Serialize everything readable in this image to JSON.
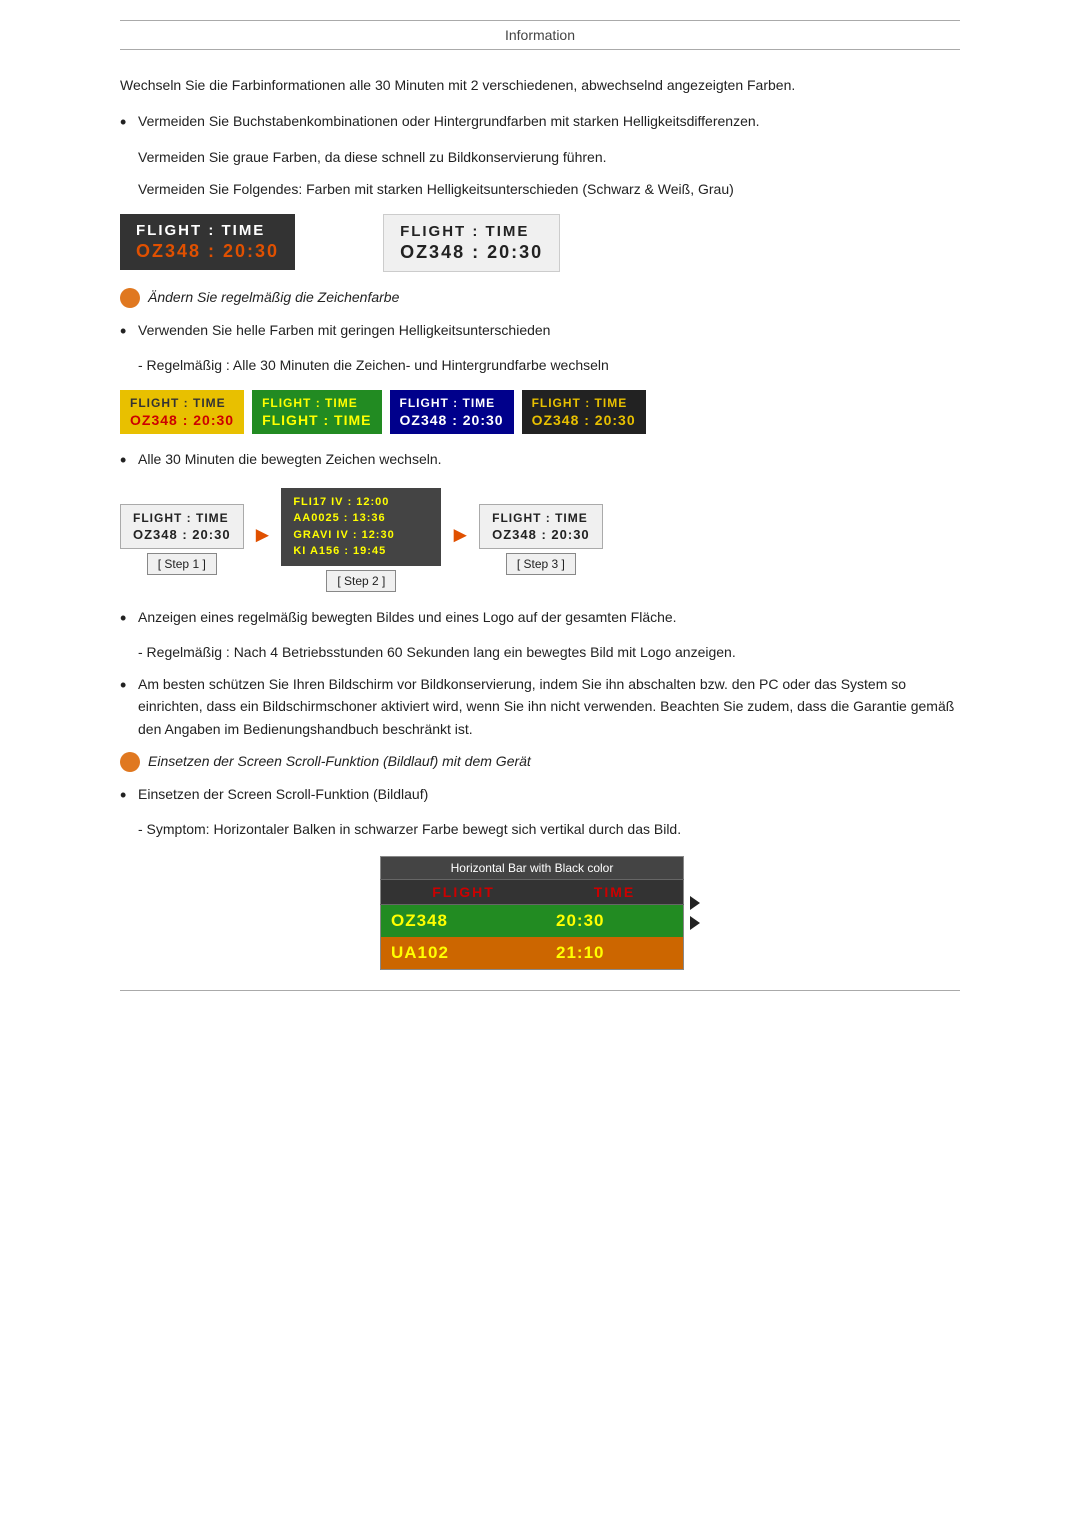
{
  "header": {
    "title": "Information"
  },
  "content": {
    "intro_paragraph": "Wechseln Sie die Farbinformationen alle 30 Minuten mit 2 verschiedenen, abwechselnd angezeigten Farben.",
    "bullet1": "Vermeiden Sie Buchstabenkombinationen oder Hintergrundfarben mit starken Helligkeitsdifferenzen.",
    "sub1": "Vermeiden Sie graue Farben, da diese schnell zu Bildkonservierung führen.",
    "sub2": "Vermeiden Sie Folgendes: Farben mit starken Helligkeitsunterschieden (Schwarz & Weiß, Grau)",
    "flight_dark_row1": "FLIGHT  :  TIME",
    "flight_dark_row2": "OZ348   :  20:30",
    "flight_light_row1": "FLIGHT  :  TIME",
    "flight_light_row2": "OZ348   :  20:30",
    "orange_label1": "Ändern Sie regelmäßig die Zeichenfarbe",
    "bullet2": "Verwenden Sie helle Farben mit geringen Helligkeitsunterschieden",
    "sub3": "- Regelmäßig : Alle 30 Minuten die Zeichen- und Hintergrundfarbe wechseln",
    "box1_r1": "FLIGHT  :  TIME",
    "box1_r2": "OZ348  :  20:30",
    "box2_r1": "FLIGHT  :  TIME",
    "box2_r2": "FLIGHT  :  TIME",
    "box3_r1": "FLIGHT  :  TIME",
    "box3_r2": "OZ348  :  20:30",
    "box4_r1": "FLIGHT  :  TIME",
    "box4_r2": "OZ348  :  20:30",
    "bullet3": "Alle 30 Minuten die bewegten Zeichen wechseln.",
    "step1_r1": "FLIGHT  :  TIME",
    "step1_r2": "OZ348  :  20:30",
    "step1_label": "[ Step 1 ]",
    "step2_a1": "FLI17 IV  :  12:00",
    "step2_a2": "AA0025  :  13:36",
    "step2_b1": "GRAVI IV  :  12:30",
    "step2_b2": "KI A156  :  19:45",
    "step2_label": "[ Step 2 ]",
    "step3_r1": "FLIGHT  :  TIME",
    "step3_r2": "OZ348  :  20:30",
    "step3_label": "[ Step 3 ]",
    "bullet4": "Anzeigen eines regelmäßig bewegten Bildes und eines Logo auf der gesamten Fläche.",
    "sub4": "- Regelmäßig : Nach 4 Betriebsstunden 60 Sekunden lang ein bewegtes Bild mit Logo anzeigen.",
    "bullet5": "Am besten schützen Sie Ihren Bildschirm vor Bildkonservierung, indem Sie ihn abschalten bzw. den PC oder das System so einrichten, dass ein Bildschirmschoner aktiviert wird, wenn Sie ihn nicht verwenden. Beachten Sie zudem, dass die Garantie gemäß den Angaben im Bedienungshandbuch beschränkt ist.",
    "orange_label2": "Einsetzen der Screen Scroll-Funktion (Bildlauf) mit dem Gerät",
    "bullet6": "Einsetzen der Screen Scroll-Funktion (Bildlauf)",
    "sub5": "- Symptom: Horizontaler Balken in schwarzer Farbe bewegt sich vertikal durch das Bild.",
    "hbar_title": "Horizontal Bar with Black color",
    "hbar_col1": "FLIGHT",
    "hbar_col2": "TIME",
    "hbar_r1c1": "OZ348",
    "hbar_r1c2": "20:30",
    "hbar_r2c1": "UA102",
    "hbar_r2c2": "21:10"
  }
}
